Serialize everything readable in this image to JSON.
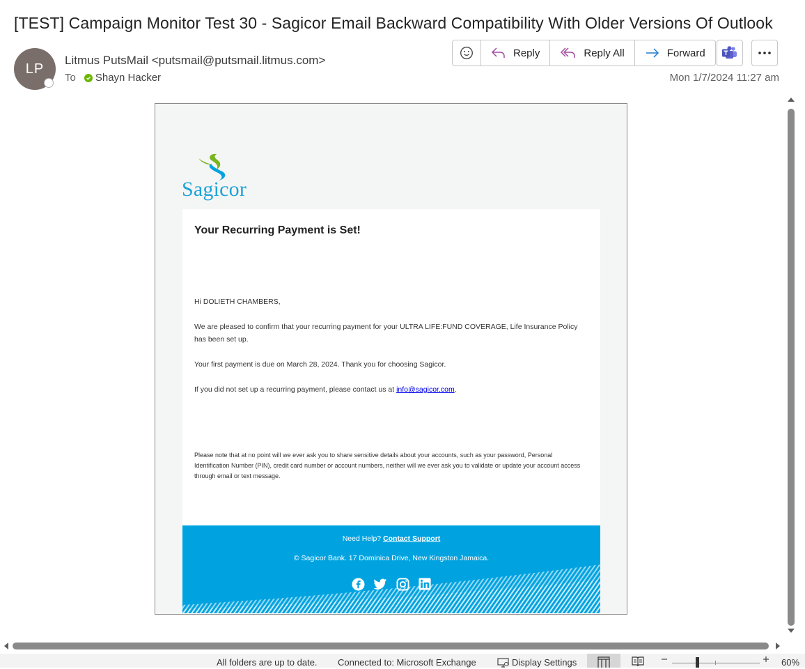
{
  "message": {
    "subject": "[TEST] Campaign Monitor Test 30 - Sagicor Email Backward Compatibility With Older Versions Of Outlook",
    "avatar_initials": "LP",
    "sender": "Litmus PutsMail <putsmail@putsmail.litmus.com>",
    "to_label": "To",
    "recipient": "Shayn Hacker",
    "date": "Mon 1/7/2024 11:27 am"
  },
  "actions": {
    "reply": "Reply",
    "reply_all": "Reply All",
    "forward": "Forward"
  },
  "email": {
    "brand": "Sagicor",
    "title": "Your Recurring Payment is Set!",
    "greeting": "Hi DOLIETH CHAMBERS,",
    "paragraph1": "We are pleased to confirm that your recurring payment for your ULTRA LIFE:FUND COVERAGE, Life Insurance Policy has been set up.",
    "paragraph2": "Your first payment is due on March 28, 2024. Thank you for choosing Sagicor.",
    "paragraph3_prefix": "If you did not set up a recurring payment, please contact us at ",
    "paragraph3_link": "info@sagicor.com",
    "paragraph3_suffix": ".",
    "notice": "Please note that at no point will we ever ask you to share sensitive details about your accounts, such as your password, Personal Identification Number (PIN), credit card number or account numbers, neither will we ever ask you to validate or update your account access through email or text message.",
    "help_prefix": "Need Help? ",
    "help_link": "Contact Support",
    "address": "© Sagicor Bank. 17 Dominica Drive, New Kingston Jamaica."
  },
  "status": {
    "sync": "All folders are up to date.",
    "connection": "Connected to: Microsoft Exchange",
    "display_settings": "Display Settings",
    "zoom": "60%"
  },
  "colors": {
    "brand_blue": "#00a3e0",
    "brand_green": "#7ab51d"
  }
}
